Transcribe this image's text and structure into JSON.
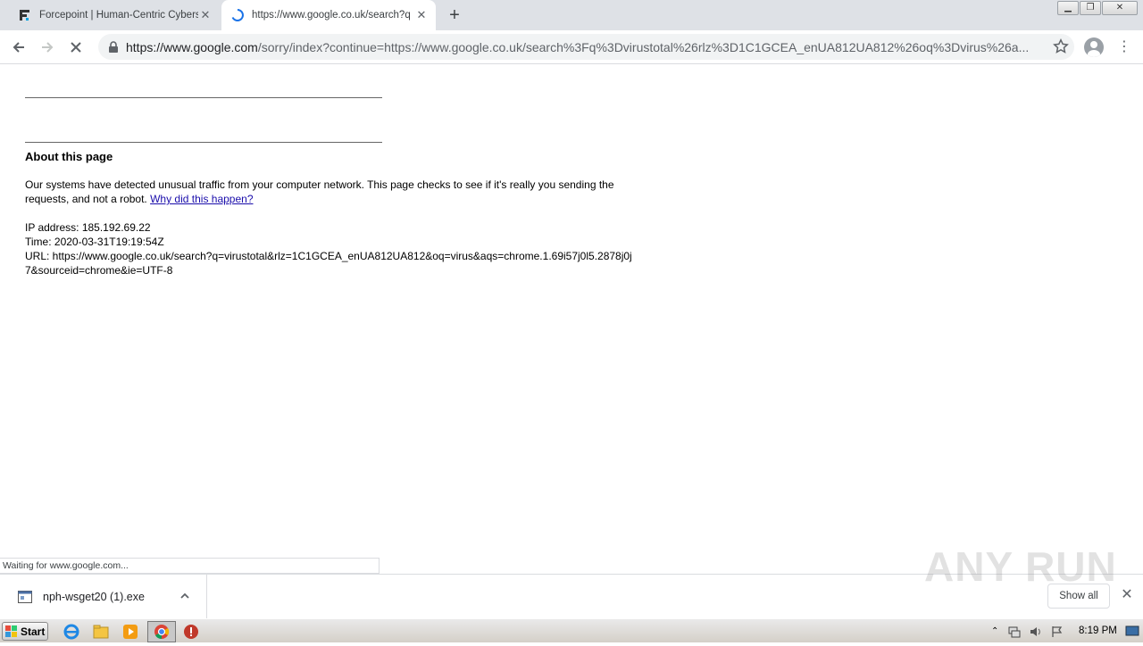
{
  "tabs": [
    {
      "title": "Forcepoint | Human-Centric Cyberse",
      "active": false
    },
    {
      "title": "https://www.google.co.uk/search?q",
      "active": true
    }
  ],
  "address": {
    "host": "https://www.google.com",
    "rest": "/sorry/index?continue=https://www.google.co.uk/search%3Fq%3Dvirustotal%26rlz%3D1C1GCEA_enUA812UA812%26oq%3Dvirus%26a..."
  },
  "page": {
    "heading": "About this page",
    "message": "Our systems have detected unusual traffic from your computer network. This page checks to see if it's really you sending the requests, and not a robot. ",
    "link": "Why did this happen?",
    "ip_line": "IP address: 185.192.69.22",
    "time_line": "Time: 2020-03-31T19:19:54Z",
    "url_line": "URL: https://www.google.co.uk/search?q=virustotal&rlz=1C1GCEA_enUA812UA812&oq=virus&aqs=chrome.1.69i57j0l5.2878j0j7&sourceid=chrome&ie=UTF-8"
  },
  "status": "Waiting for www.google.com...",
  "downloads": {
    "file": "nph-wsget20 (1).exe",
    "show_all": "Show all"
  },
  "watermark": "ANY RUN",
  "taskbar": {
    "start": "Start",
    "clock": "8:19 PM"
  },
  "colors": {
    "link": "#1a0dab",
    "tabstrip": "#dee1e6"
  }
}
